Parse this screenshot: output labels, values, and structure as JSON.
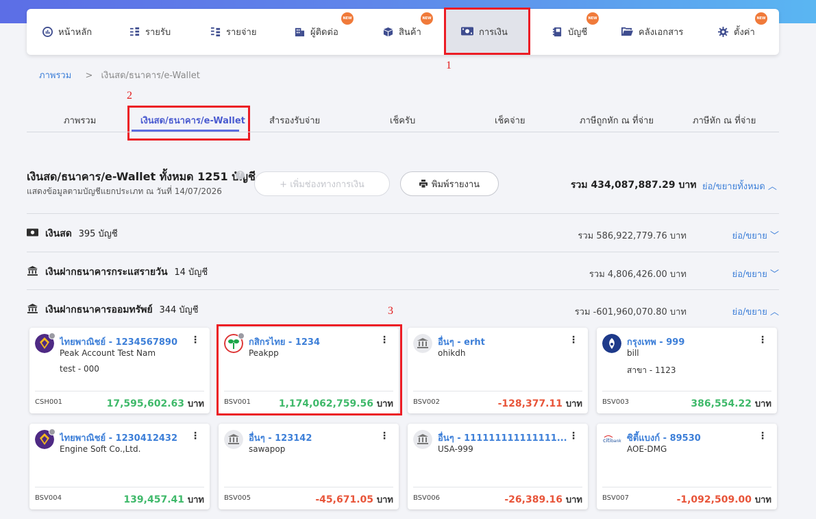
{
  "nav": {
    "items": [
      {
        "label": "หน้าหลัก",
        "icon": "dashboard-icon",
        "new": false
      },
      {
        "label": "รายรับ",
        "icon": "income-icon",
        "new": false
      },
      {
        "label": "รายจ่าย",
        "icon": "expense-icon",
        "new": false
      },
      {
        "label": "ผู้ติดต่อ",
        "icon": "contacts-icon",
        "new": true
      },
      {
        "label": "สินค้า",
        "icon": "product-box-icon",
        "new": true
      },
      {
        "label": "การเงิน",
        "icon": "money-icon",
        "new": false,
        "active": true
      },
      {
        "label": "บัญชี",
        "icon": "ledger-book-icon",
        "new": true
      },
      {
        "label": "คลังเอกสาร",
        "icon": "folder-icon",
        "new": false
      },
      {
        "label": "ตั้งค่า",
        "icon": "gear-icon",
        "new": true
      }
    ],
    "badge_text": "NEW"
  },
  "annotations": {
    "n1": "1",
    "n2": "2",
    "n3": "3"
  },
  "breadcrumb": {
    "root": "ภาพรวม",
    "sep": ">",
    "current": "เงินสด/ธนาคาร/e-Wallet"
  },
  "subtabs": [
    "ภาพรวม",
    "เงินสด/ธนาคาร/e-Wallet",
    "สำรองรับจ่าย",
    "เช็ครับ",
    "เช็คจ่าย",
    "ภาษีถูกหัก ณ ที่จ่าย",
    "ภาษีหัก ณ ที่จ่าย"
  ],
  "summary": {
    "title": "เงินสด/ธนาคาร/e-Wallet ทั้งหมด 1251 บัญชี",
    "subtitle": "แสดงข้อมูลตามบัญชีแยกประเภท ณ วันที่ 14/07/2026",
    "add_button": "+ เพิ่มช่องทางการเงิน",
    "print_button": "พิมพ์รายงาน",
    "total": "รวม 434,087,887.29 บาท",
    "toggle_all": "ย่อ/ขยายทั้งหมด"
  },
  "sections": [
    {
      "name": "เงินสด",
      "count": "395 บัญชี",
      "total": "รวม 586,922,779.76 บาท",
      "toggle": "ย่อ/ขยาย",
      "icon": "cash-icon"
    },
    {
      "name": "เงินฝากธนาคารกระแสรายวัน",
      "count": "14 บัญชี",
      "total": "รวม 4,806,426.00 บาท",
      "toggle": "ย่อ/ขยาย",
      "icon": "bank-icon"
    },
    {
      "name": "เงินฝากธนาคารออมทรัพย์",
      "count": "344 บัญชี",
      "total": "รวม -601,960,070.80 บาท",
      "toggle": "ย่อ/ขยาย",
      "icon": "bank-icon"
    }
  ],
  "cards": [
    {
      "name": "ไทยพาณิชย์ - 1234567890",
      "line1": "Peak Account Test Nam",
      "line2": "test - 000",
      "code": "CSH001",
      "amount": "17,595,602.63",
      "unit": "บาท",
      "sign": "pos",
      "logo": "scb-logo-icon"
    },
    {
      "name": "กสิกรไทย - 1234",
      "line1": "Peakpp",
      "line2": "",
      "code": "BSV001",
      "amount": "1,174,062,759.56",
      "unit": "บาท",
      "sign": "pos",
      "logo": "kbank-logo-icon"
    },
    {
      "name": "อื่นๆ - erht",
      "line1": "ohikdh",
      "line2": "",
      "code": "BSV002",
      "amount": "-128,377.11",
      "unit": "บาท",
      "sign": "neg",
      "logo": "bank-icon"
    },
    {
      "name": "กรุงเทพ - 999",
      "line1": "bill",
      "line2": "สาขา - 1123",
      "code": "BSV003",
      "amount": "386,554.22",
      "unit": "บาท",
      "sign": "pos",
      "logo": "bbl-logo-icon"
    },
    {
      "name": "ไทยพาณิชย์ - 1230412432",
      "line1": "Engine Soft Co.,Ltd.",
      "line2": "",
      "code": "BSV004",
      "amount": "139,457.41",
      "unit": "บาท",
      "sign": "pos",
      "logo": "scb-logo-icon"
    },
    {
      "name": "อื่นๆ - 123142",
      "line1": "sawapop",
      "line2": "",
      "code": "BSV005",
      "amount": "-45,671.05",
      "unit": "บาท",
      "sign": "neg",
      "logo": "bank-icon"
    },
    {
      "name": "อื่นๆ - 111111111111111...",
      "line1": "USA-999",
      "line2": "",
      "code": "BSV006",
      "amount": "-26,389.16",
      "unit": "บาท",
      "sign": "neg",
      "logo": "bank-icon"
    },
    {
      "name": "ซิตี้แบงก์ - 89530",
      "line1": "AOE-DMG",
      "line2": "",
      "code": "BSV007",
      "amount": "-1,092,509.00",
      "unit": "บาท",
      "sign": "neg",
      "logo": "citibank-logo-icon"
    }
  ]
}
